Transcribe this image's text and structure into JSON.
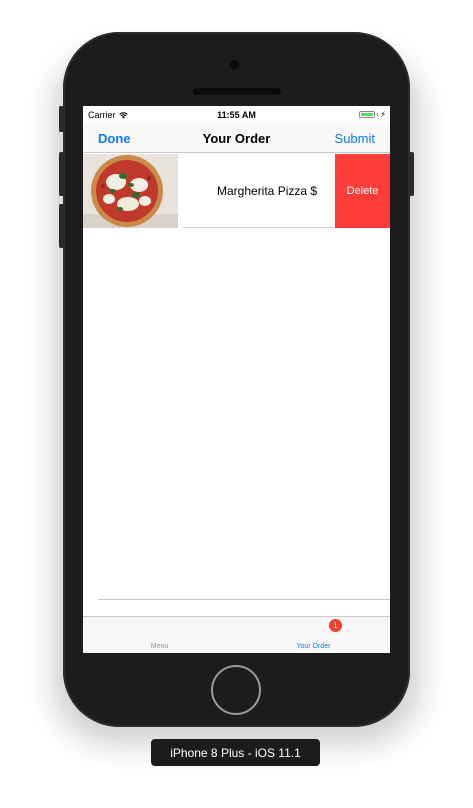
{
  "status_bar": {
    "carrier": "Carrier",
    "time": "11:55 AM"
  },
  "nav": {
    "done": "Done",
    "title": "Your Order",
    "submit": "Submit"
  },
  "order_items": [
    {
      "name": "Margherita Pizza",
      "price_partial": "$",
      "image": "margherita-pizza-photo"
    }
  ],
  "row_action": {
    "delete": "Delete"
  },
  "tab_bar": {
    "menu": "Menu",
    "your_order": "Your Order",
    "order_badge": "1",
    "selected": "Your Order"
  },
  "device_label": "iPhone 8 Plus - iOS 11.1",
  "colors": {
    "tint": "#0a7aff",
    "delete": "#fd3d39",
    "badge": "#ff3b30",
    "battery": "#4cd964"
  }
}
